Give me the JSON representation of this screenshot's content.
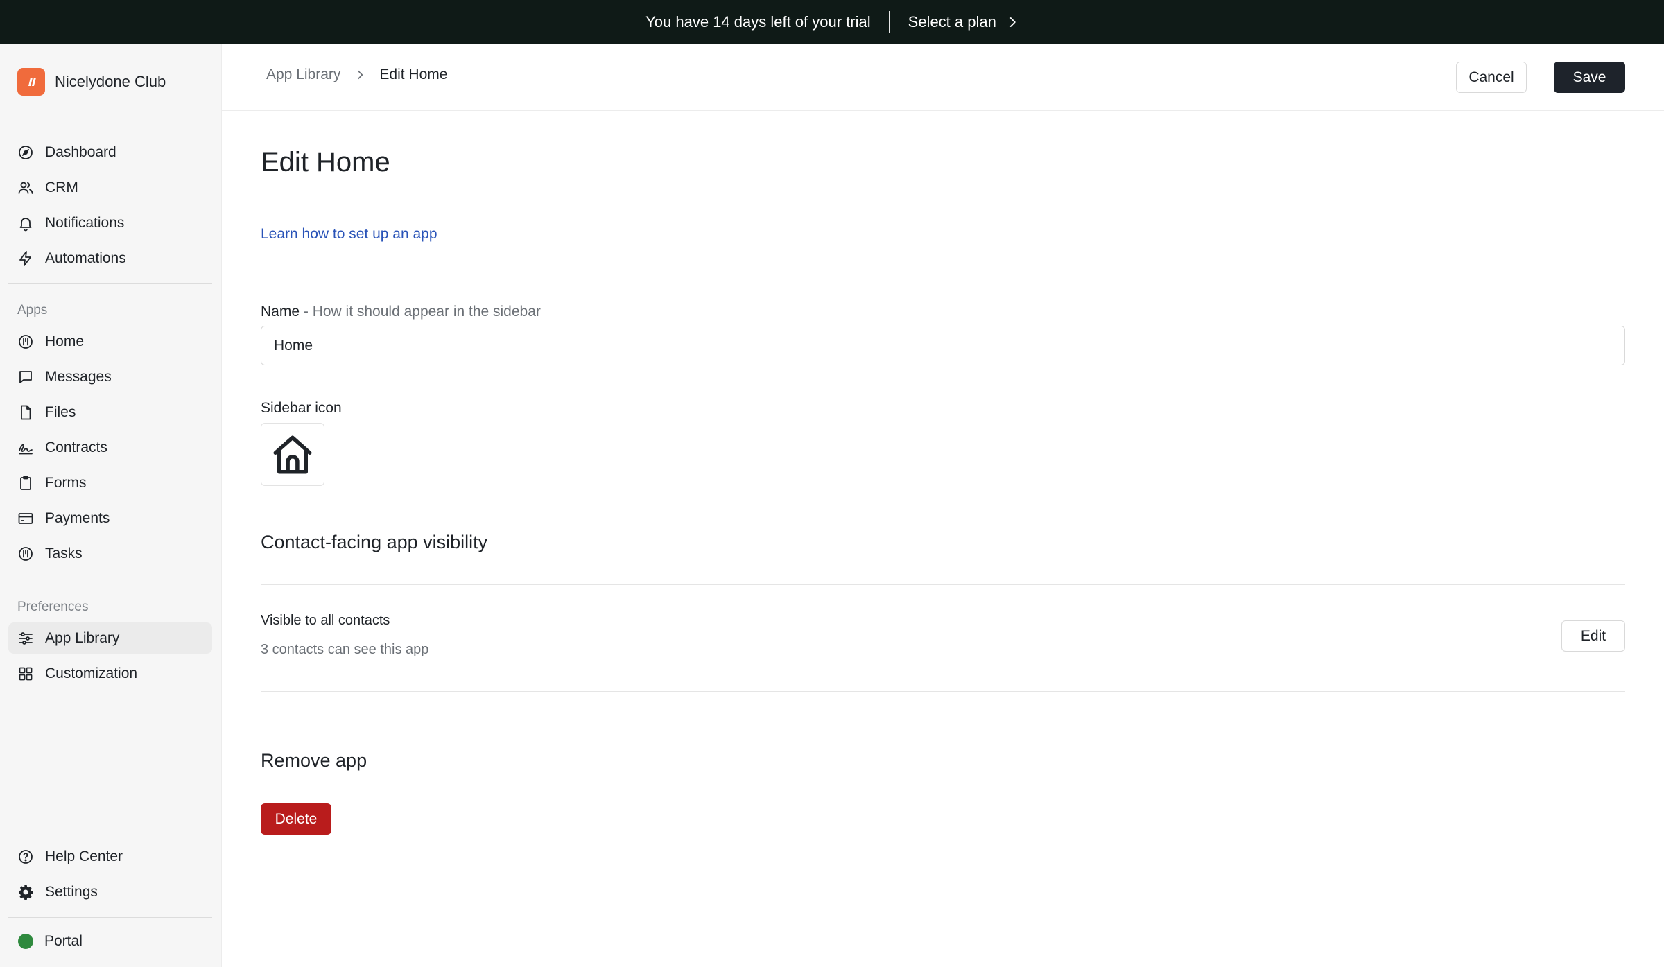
{
  "banner": {
    "trial_text": "You have 14 days left of your trial",
    "plan_link": "Select a plan"
  },
  "brand": {
    "name": "Nicelydone Club",
    "logo_color": "#f06b3c"
  },
  "sidebar": {
    "main_items": [
      {
        "label": "Dashboard",
        "icon": "compass-icon"
      },
      {
        "label": "CRM",
        "icon": "users-icon"
      },
      {
        "label": "Notifications",
        "icon": "bell-icon"
      },
      {
        "label": "Automations",
        "icon": "lightning-icon"
      }
    ],
    "apps_label": "Apps",
    "apps_items": [
      {
        "label": "Home",
        "icon": "app-circle-icon"
      },
      {
        "label": "Messages",
        "icon": "chat-bubble-icon"
      },
      {
        "label": "Files",
        "icon": "file-icon"
      },
      {
        "label": "Contracts",
        "icon": "signature-icon"
      },
      {
        "label": "Forms",
        "icon": "clipboard-icon"
      },
      {
        "label": "Payments",
        "icon": "credit-card-icon"
      },
      {
        "label": "Tasks",
        "icon": "app-circle-icon"
      }
    ],
    "preferences_label": "Preferences",
    "preferences_items": [
      {
        "label": "App Library",
        "icon": "sliders-icon",
        "active": true
      },
      {
        "label": "Customization",
        "icon": "grid-icon"
      }
    ],
    "bottom_items": [
      {
        "label": "Help Center",
        "icon": "question-circle-icon"
      },
      {
        "label": "Settings",
        "icon": "gear-icon"
      }
    ],
    "portal": {
      "label": "Portal",
      "status_color": "#2f8a3e"
    }
  },
  "header": {
    "breadcrumb_parent": "App Library",
    "breadcrumb_current": "Edit Home",
    "cancel_label": "Cancel",
    "save_label": "Save"
  },
  "page": {
    "title": "Edit Home",
    "learn_link": "Learn how to set up an app",
    "name_label": "Name",
    "name_hint": " - How it should appear in the sidebar",
    "name_value": "Home",
    "sidebar_icon_label": "Sidebar icon",
    "sidebar_icon": "house-icon",
    "visibility_heading": "Contact-facing app visibility",
    "visibility_title": "Visible to all contacts",
    "visibility_sub": "3 contacts can see this app",
    "visibility_edit_label": "Edit",
    "remove_heading": "Remove app",
    "delete_label": "Delete",
    "delete_color": "#b91c1c"
  }
}
